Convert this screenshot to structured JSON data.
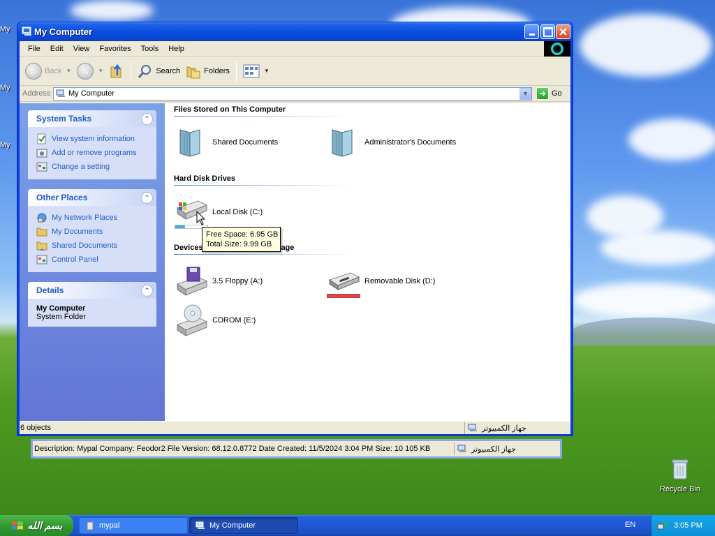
{
  "desktop": {
    "recycle_bin_label": "Recycle Bin",
    "left_labels": [
      "My",
      "My",
      "My"
    ]
  },
  "window": {
    "title": "My Computer",
    "menu": [
      "File",
      "Edit",
      "View",
      "Favorites",
      "Tools",
      "Help"
    ],
    "toolbar": {
      "back": "Back",
      "search": "Search",
      "folders": "Folders"
    },
    "address": {
      "label": "Address",
      "value": "My Computer",
      "go": "Go"
    },
    "task_panels": [
      {
        "title": "System Tasks",
        "links": [
          "View system information",
          "Add or remove programs",
          "Change a setting"
        ]
      },
      {
        "title": "Other Places",
        "links": [
          "My Network Places",
          "My Documents",
          "Shared Documents",
          "Control Panel"
        ]
      },
      {
        "title": "Details",
        "name": "My Computer",
        "type": "System Folder"
      }
    ],
    "groups": {
      "files_stored": "Files Stored on This Computer",
      "hard_disks": "Hard Disk Drives",
      "devices": "Devices with Removable Storage"
    },
    "items": {
      "shared_docs": "Shared Documents",
      "admin_docs": "Administrator's Documents",
      "local_disk": "Local Disk (C:)",
      "floppy": "3.5 Floppy (A:)",
      "removable": "Removable Disk (D:)",
      "cdrom": "CDROM (E:)"
    },
    "local_disk_used_fraction": 0.3,
    "tooltip": {
      "free": "Free Space: 6.95 GB",
      "total": "Total Size: 9.99 GB"
    },
    "status": {
      "count": "6 objects",
      "zone": "جهاز الكمبيوتر"
    }
  },
  "description_bar": {
    "text": "Description: Mypal Company: Feodor2 File Version: 68.12.0.8772 Date Created: 11/5/2024 3:04 PM Size: 10 105 KB",
    "zone": "جهاز الكمبيوتر"
  },
  "taskbar": {
    "start": "بسم الله",
    "tasks": [
      "mypal",
      "My Computer"
    ],
    "language": "EN",
    "clock": "3:05 PM"
  }
}
